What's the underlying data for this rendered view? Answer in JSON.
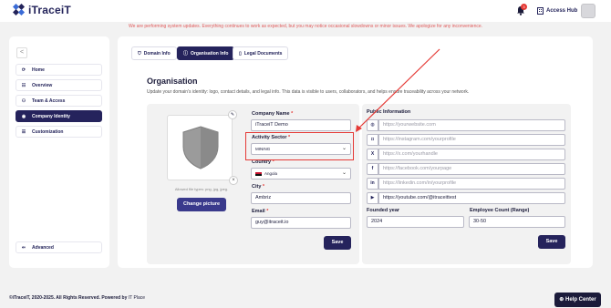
{
  "app": {
    "logo_text": "iTraceiT"
  },
  "banner": "We are performing system updates. Everything continues to work as expected, but you may notice occasional slowdowns or minor issues. We apologize for any inconvenience.",
  "header": {
    "notif_count": "3",
    "access_hub": "Access Hub"
  },
  "sidebar": {
    "collapse": "<",
    "items": [
      {
        "label": "Home",
        "icon": "home-icon"
      },
      {
        "label": "Overview",
        "icon": "grid-icon"
      },
      {
        "label": "Team & Access",
        "icon": "users-icon"
      },
      {
        "label": "Company Identity",
        "icon": "id-icon",
        "active": true
      },
      {
        "label": "Customization",
        "icon": "list-icon"
      }
    ],
    "advanced": "Advanced"
  },
  "tabs": [
    {
      "label": "Domain Info"
    },
    {
      "label": "Organisation Info",
      "active": true
    },
    {
      "label": "Legal Documents"
    }
  ],
  "main": {
    "title": "Organisation",
    "subtitle": "Update your domain's identity: logo, contact details, and legal info. This data is visible to users, collaborators, and helps ensure traceability across your network."
  },
  "logo_card": {
    "allowed": "Allowed file types: png, jpg, jpeg.",
    "change_label": "Change picture"
  },
  "form": {
    "company_name": {
      "label": "Company Name",
      "req": "*",
      "value": "iTraceiT Demo"
    },
    "activity_sector": {
      "label": "Activity Sector",
      "req": "*",
      "value": "MINING"
    },
    "country": {
      "label": "Country",
      "req": "*",
      "value": "Angola"
    },
    "city": {
      "label": "City",
      "req": "*",
      "value": "Ambriz"
    },
    "email": {
      "label": "Email",
      "req": "*",
      "value": "guy@itraceit.io"
    },
    "save": "Save"
  },
  "public": {
    "title": "Public Information",
    "website": {
      "icon": "globe-icon",
      "placeholder": "https://yourwebsite.com"
    },
    "instagram": {
      "icon": "instagram-icon",
      "placeholder": "https://instagram.com/yourprofile"
    },
    "x": {
      "icon": "x-icon",
      "placeholder": "https://x.com/yourhandle"
    },
    "facebook": {
      "icon": "facebook-icon",
      "placeholder": "https://facebook.com/yourpage"
    },
    "linkedin": {
      "icon": "linkedin-icon",
      "placeholder": "https://linkedin.com/in/yourprofile"
    },
    "youtube": {
      "icon": "youtube-icon",
      "value": "https://youtube.com/@itraceittest"
    },
    "founded": {
      "label": "Founded year",
      "value": "2024"
    },
    "employees": {
      "label": "Employee Count (Range)",
      "value": "30-50"
    },
    "save": "Save"
  },
  "footer": {
    "copyright": "©iTraceiT, 2020-2025. All Rights Reserved. Powered by",
    "powered": "IT Place"
  },
  "help": {
    "label": "Help Center"
  },
  "colors": {
    "accent": "#25235c",
    "annotation": "#e53935",
    "banner": "#e05a5a"
  }
}
